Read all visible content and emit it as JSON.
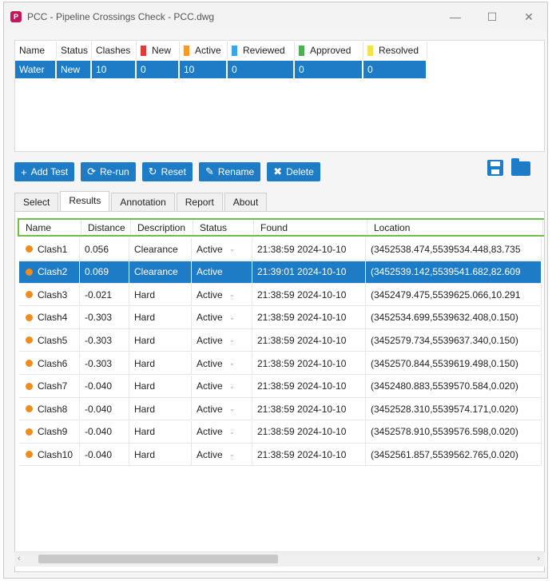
{
  "window": {
    "title": "PCC - Pipeline Crossings Check - PCC.dwg",
    "app_icon": "P",
    "minimize": "—",
    "maximize": "☐",
    "close": "✕"
  },
  "summary": {
    "headers": [
      {
        "label": "Name"
      },
      {
        "label": "Status"
      },
      {
        "label": "Clashes"
      },
      {
        "label": "New",
        "color": "#e53935"
      },
      {
        "label": "Active",
        "color": "#f59b2b"
      },
      {
        "label": "Reviewed",
        "color": "#3aa5e8"
      },
      {
        "label": "Approved",
        "color": "#4caf50"
      },
      {
        "label": "Resolved",
        "color": "#f4e24a"
      }
    ],
    "row": [
      "Water",
      "New",
      "10",
      "0",
      "10",
      "0",
      "0",
      "0"
    ]
  },
  "toolbar": {
    "buttons": [
      {
        "label": "Add Test",
        "icon": "+"
      },
      {
        "label": "Re-run",
        "icon": "⟳"
      },
      {
        "label": "Reset",
        "icon": "↻"
      },
      {
        "label": "Rename",
        "icon": "✎"
      },
      {
        "label": "Delete",
        "icon": "✖"
      }
    ]
  },
  "tabs": [
    {
      "label": "Select",
      "active": false
    },
    {
      "label": "Results",
      "active": true
    },
    {
      "label": "Annotation",
      "active": false
    },
    {
      "label": "Report",
      "active": false
    },
    {
      "label": "About",
      "active": false
    }
  ],
  "results": {
    "columns": [
      "Name",
      "Distance",
      "Description",
      "Status",
      "Found",
      "Location"
    ],
    "selected_index": 1,
    "rows": [
      {
        "name": "Clash1",
        "distance": "0.056",
        "description": "Clearance",
        "status": "Active",
        "found": "21:38:59 2024-10-10",
        "location": "(3452538.474,5539534.448,83.735"
      },
      {
        "name": "Clash2",
        "distance": "0.069",
        "description": "Clearance",
        "status": "Active",
        "found": "21:39:01 2024-10-10",
        "location": "(3452539.142,5539541.682,82.609"
      },
      {
        "name": "Clash3",
        "distance": "-0.021",
        "description": "Hard",
        "status": "Active",
        "found": "21:38:59 2024-10-10",
        "location": "(3452479.475,5539625.066,10.291"
      },
      {
        "name": "Clash4",
        "distance": "-0.303",
        "description": "Hard",
        "status": "Active",
        "found": "21:38:59 2024-10-10",
        "location": "(3452534.699,5539632.408,0.150)"
      },
      {
        "name": "Clash5",
        "distance": "-0.303",
        "description": "Hard",
        "status": "Active",
        "found": "21:38:59 2024-10-10",
        "location": "(3452579.734,5539637.340,0.150)"
      },
      {
        "name": "Clash6",
        "distance": "-0.303",
        "description": "Hard",
        "status": "Active",
        "found": "21:38:59 2024-10-10",
        "location": "(3452570.844,5539619.498,0.150)"
      },
      {
        "name": "Clash7",
        "distance": "-0.040",
        "description": "Hard",
        "status": "Active",
        "found": "21:38:59 2024-10-10",
        "location": "(3452480.883,5539570.584,0.020)"
      },
      {
        "name": "Clash8",
        "distance": "-0.040",
        "description": "Hard",
        "status": "Active",
        "found": "21:38:59 2024-10-10",
        "location": "(3452528.310,5539574.171,0.020)"
      },
      {
        "name": "Clash9",
        "distance": "-0.040",
        "description": "Hard",
        "status": "Active",
        "found": "21:38:59 2024-10-10",
        "location": "(3452578.910,5539576.598,0.020)"
      },
      {
        "name": "Clash10",
        "distance": "-0.040",
        "description": "Hard",
        "status": "Active",
        "found": "21:38:59 2024-10-10",
        "location": "(3452561.857,5539562.765,0.020)"
      }
    ]
  },
  "colors": {
    "accent": "#1e7bc5",
    "clash_dot": "#ef8c1e",
    "highlight_border": "#6cbf4a"
  }
}
